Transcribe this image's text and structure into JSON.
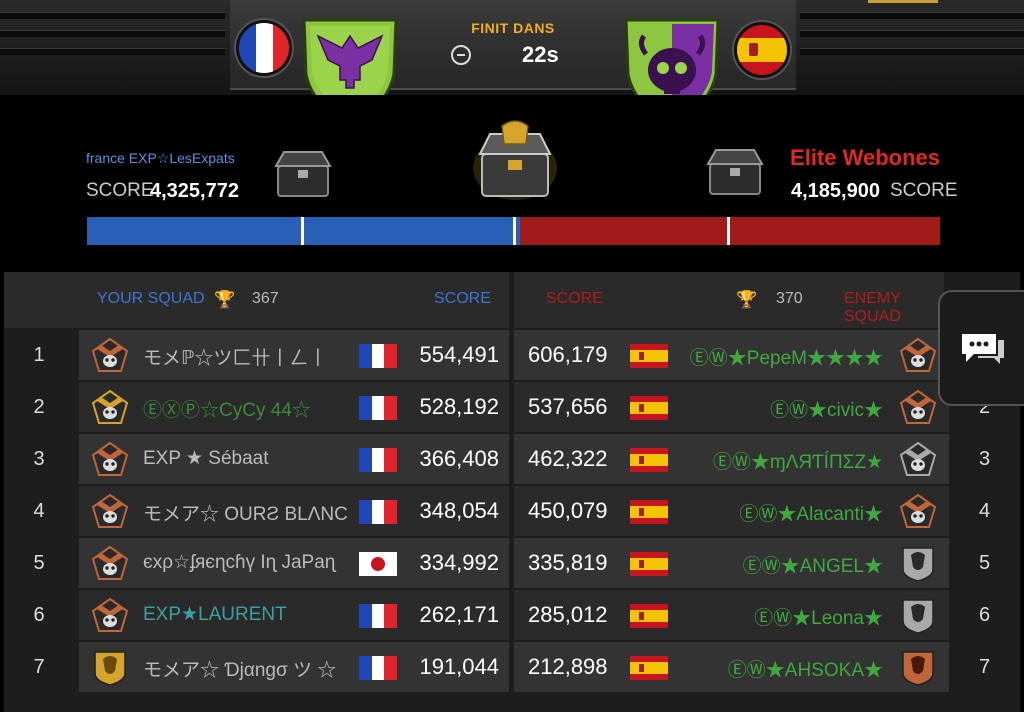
{
  "header": {
    "timer_label": "FINIT DANS",
    "timer_value": "22s",
    "left_flag": "france",
    "right_flag": "spain",
    "left_emblem": "eagle-shield-icon",
    "right_emblem": "skull-shield-icon"
  },
  "teams": {
    "left": {
      "name": "france EXP☆LesExpats",
      "score_label": "SCORE",
      "score": "4,325,772",
      "color": "#2a5fb8"
    },
    "right": {
      "name": "Elite Webones",
      "score_label": "SCORE",
      "score": "4,185,900",
      "color": "#a01a18"
    }
  },
  "progress": {
    "left_fraction": 0.508
  },
  "table": {
    "left_header": "YOUR SQUAD",
    "left_trophies": "367",
    "left_score_header": "SCORE",
    "right_score_header": "SCORE",
    "right_trophies": "370",
    "right_header": "ENEMY SQUAD",
    "rows": [
      {
        "rank": "1",
        "left_badge": "bronze-skull",
        "left_name": "モメℙ☆ツ匚卄丨ㄥ丨",
        "left_name_color": "#bbbbbb",
        "left_flag": "france",
        "left_score": "554,491",
        "right_score": "606,179",
        "right_flag": "spain",
        "right_name": "ⒺⓌ★PepeM★★★★",
        "right_name_color": "#3fa83f",
        "right_badge": "bronze-skull",
        "right_rank": ""
      },
      {
        "rank": "2",
        "left_badge": "gold-skull",
        "left_name": "ⒺⓍⓅ☆CyCy 44☆",
        "left_name_color": "#3a8a3a",
        "left_flag": "france",
        "left_score": "528,192",
        "right_score": "537,656",
        "right_flag": "spain",
        "right_name": "ⒺⓌ★civic★",
        "right_name_color": "#3fa83f",
        "right_badge": "bronze-skull",
        "right_rank": "2"
      },
      {
        "rank": "3",
        "left_badge": "bronze-skull",
        "left_name": "EXP ★ Sébaat",
        "left_name_color": "#bbbbbb",
        "left_flag": "france",
        "left_score": "366,408",
        "right_score": "462,322",
        "right_flag": "spain",
        "right_name": "ⒺⓌ★ɱΛЯƬÍПΣZ★",
        "right_name_color": "#3fa83f",
        "right_badge": "silver-skull",
        "right_rank": "3"
      },
      {
        "rank": "4",
        "left_badge": "bronze-skull",
        "left_name": "モメア☆ OURƧ BLΛNC",
        "left_name_color": "#bbbbbb",
        "left_flag": "france",
        "left_score": "348,054",
        "right_score": "450,079",
        "right_flag": "spain",
        "right_name": "ⒺⓌ★Alacanti★",
        "right_name_color": "#3fa83f",
        "right_badge": "bronze-skull",
        "right_rank": "4"
      },
      {
        "rank": "5",
        "left_badge": "bronze-skull",
        "left_name": "єxρ☆ʄяєɳcɦү Iɳ JaPaɳ",
        "left_name_color": "#bbbbbb",
        "left_flag": "japan",
        "left_score": "334,992",
        "right_score": "335,819",
        "right_flag": "spain",
        "right_name": "ⒺⓌ★ANGEL★",
        "right_name_color": "#3fa83f",
        "right_badge": "silver-lion",
        "right_rank": "5"
      },
      {
        "rank": "6",
        "left_badge": "bronze-skull",
        "left_name": "EXP★LAURENT",
        "left_name_color": "#3aa0a0",
        "left_flag": "france",
        "left_score": "262,171",
        "right_score": "285,012",
        "right_flag": "spain",
        "right_name": "ⒺⓌ★Leona★",
        "right_name_color": "#3fa83f",
        "right_badge": "silver-lion",
        "right_rank": "6"
      },
      {
        "rank": "7",
        "left_badge": "gold-lion",
        "left_name": "モメア☆ Ɗjαngσ ツ ☆",
        "left_name_color": "#bbbbbb",
        "left_flag": "france",
        "left_score": "191,044",
        "right_score": "212,898",
        "right_flag": "spain",
        "right_name": "ⒺⓌ★AHSOKA★",
        "right_name_color": "#3fa83f",
        "right_badge": "bronze-lion",
        "right_rank": "7"
      }
    ]
  },
  "chat": {
    "icon": "chat-bubbles-icon"
  }
}
